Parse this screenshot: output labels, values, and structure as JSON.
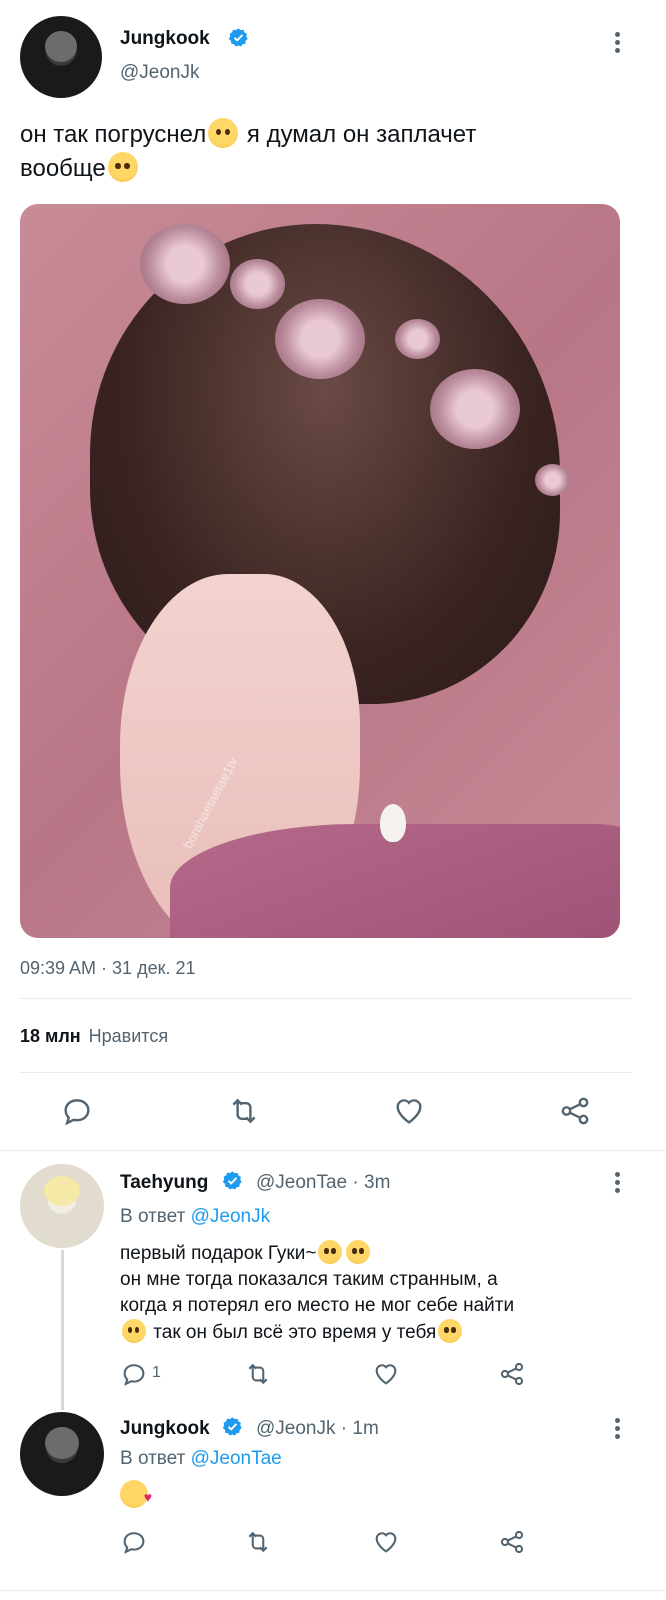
{
  "tweet": {
    "author": {
      "name": "Jungkook",
      "handle": "@JeonJk"
    },
    "text_line1": "он так погруснел",
    "text_line1b": " я думал он заплачет",
    "text_line2": "вообще",
    "image_watermark": "borahaetaetae1tv",
    "timestamp": "09:39 AM · 31 дек. 21",
    "likes_count": "18 млн",
    "likes_label": "Нравится"
  },
  "actions": [
    "reply-icon",
    "retweet-icon",
    "like-icon",
    "share-icon"
  ],
  "replies": [
    {
      "name": "Taehyung",
      "handle": "@JeonTae",
      "time": "· 3m",
      "replying_prefix": "В ответ",
      "replying_to": "@JeonJk",
      "line1": "первый подарок Гуки~",
      "line2": "он мне тогда показался таким странным, а",
      "line3": "когда я потерял его место не мог себе найти",
      "line4": " так он был всё это время у тебя",
      "reply_count": "1"
    },
    {
      "name": "Jungkook",
      "handle": "@JeonJk",
      "time": "· 1m",
      "replying_prefix": "В ответ",
      "replying_to": "@JeonTae",
      "reply_count": ""
    }
  ],
  "colors": {
    "accent": "#1d9bf0",
    "text": "#0f1419",
    "muted": "#536471",
    "divider": "#e6ecf0"
  }
}
